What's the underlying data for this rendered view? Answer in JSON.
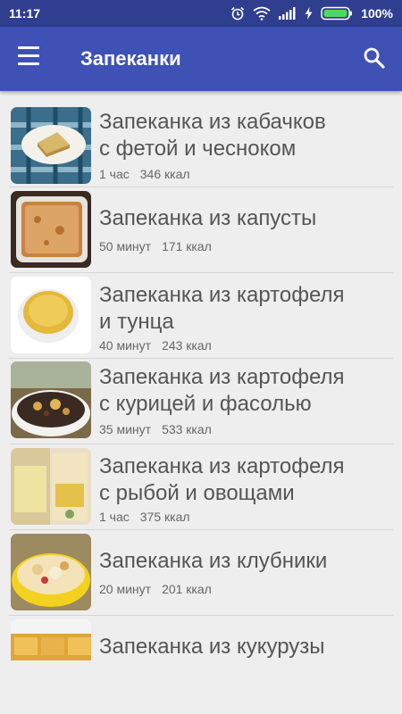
{
  "status_bar": {
    "time": "11:17",
    "battery": "100%"
  },
  "app_bar": {
    "title": "Запеканки"
  },
  "recipes": [
    {
      "title_line1": "Запеканка из кабачков",
      "title_line2": "с фетой и чесноком",
      "time": "1 час",
      "kcal": "346 ккал"
    },
    {
      "title_line1": "Запеканка из капусты",
      "title_line2": "",
      "time": "50 минут",
      "kcal": "171 ккал"
    },
    {
      "title_line1": "Запеканка из картофеля",
      "title_line2": "и тунца",
      "time": "40 минут",
      "kcal": "243 ккал"
    },
    {
      "title_line1": "Запеканка из картофеля",
      "title_line2": "с курицей и фасолью",
      "time": "35 минут",
      "kcal": "533 ккал"
    },
    {
      "title_line1": "Запеканка из картофеля",
      "title_line2": "с рыбой и овощами",
      "time": "1 час",
      "kcal": "375 ккал"
    },
    {
      "title_line1": "Запеканка из клубники",
      "title_line2": "",
      "time": "20 минут",
      "kcal": "201 ккал"
    },
    {
      "title_line1": "Запеканка из кукурузы",
      "title_line2": "",
      "time": "",
      "kcal": ""
    }
  ],
  "colors": {
    "status_bar": "#2f3e8f",
    "app_bar": "#3f51b5",
    "background": "#eeeeee"
  }
}
